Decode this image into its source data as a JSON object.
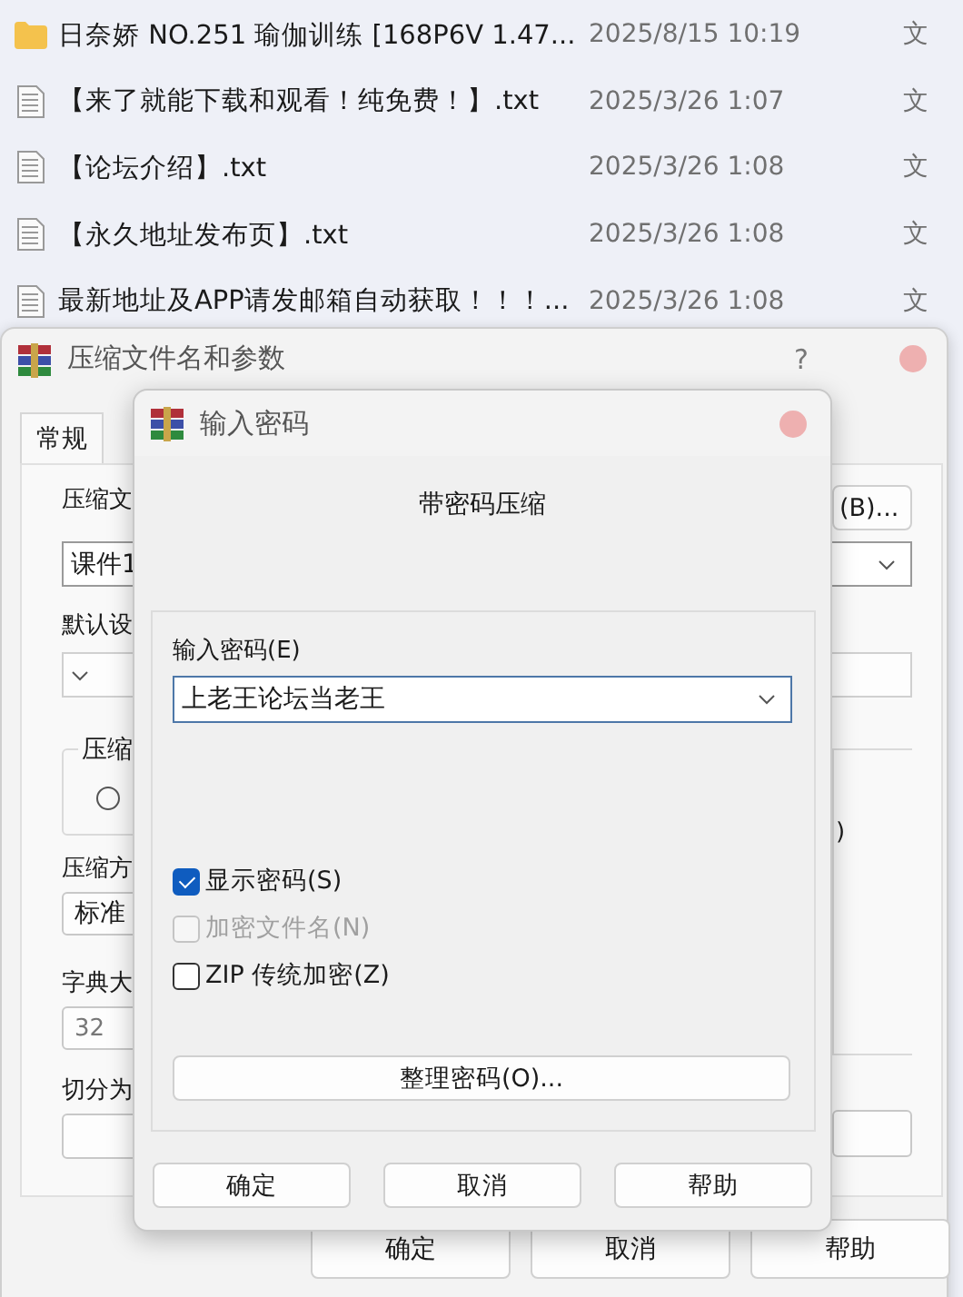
{
  "file_list": {
    "rows": [
      {
        "kind": "folder",
        "name": "日奈娇 NO.251 瑜伽训练 [168P6V 1.47...",
        "date": "2025/8/15 10:19",
        "type": "文"
      },
      {
        "kind": "text",
        "name": "【来了就能下载和观看！纯免费！】.txt",
        "date": "2025/3/26 1:07",
        "type": "文"
      },
      {
        "kind": "text",
        "name": "【论坛介绍】.txt",
        "date": "2025/3/26 1:08",
        "type": "文"
      },
      {
        "kind": "text",
        "name": "【永久地址发布页】.txt",
        "date": "2025/3/26 1:08",
        "type": "文"
      },
      {
        "kind": "text",
        "name": "最新地址及APP请发邮箱自动获取！！！...",
        "date": "2025/3/26 1:08",
        "type": "文"
      }
    ]
  },
  "archive_window": {
    "title": "压缩文件名和参数",
    "help": "?",
    "tabs": [
      {
        "label": "常规",
        "selected": true
      }
    ],
    "archive_name_label": "压缩文",
    "archive_name": "课件1",
    "browse_button": "(B)...",
    "profile_label": "默认设",
    "group_label": "压缩",
    "radio": {
      "selected": false
    },
    "group_right_text": ")",
    "method_label": "压缩方",
    "method": "标准",
    "dict_label": "字典大",
    "dict": "32",
    "split_label": "切分为",
    "buttons": [
      "确定",
      "取消",
      "帮助"
    ]
  },
  "password_dialog": {
    "title": "输入密码",
    "heading": "带密码压缩",
    "password_label": "输入密码(E)",
    "password": "上老王论坛当老王",
    "options": [
      {
        "label": "显示密码(S)",
        "checked": true,
        "disabled": false
      },
      {
        "label": "加密文件名(N)",
        "checked": false,
        "disabled": true
      },
      {
        "label": "ZIP 传统加密(Z)",
        "checked": false,
        "disabled": false
      }
    ],
    "organize_button": "整理密码(O)...",
    "buttons": [
      "确定",
      "取消",
      "帮助"
    ]
  }
}
